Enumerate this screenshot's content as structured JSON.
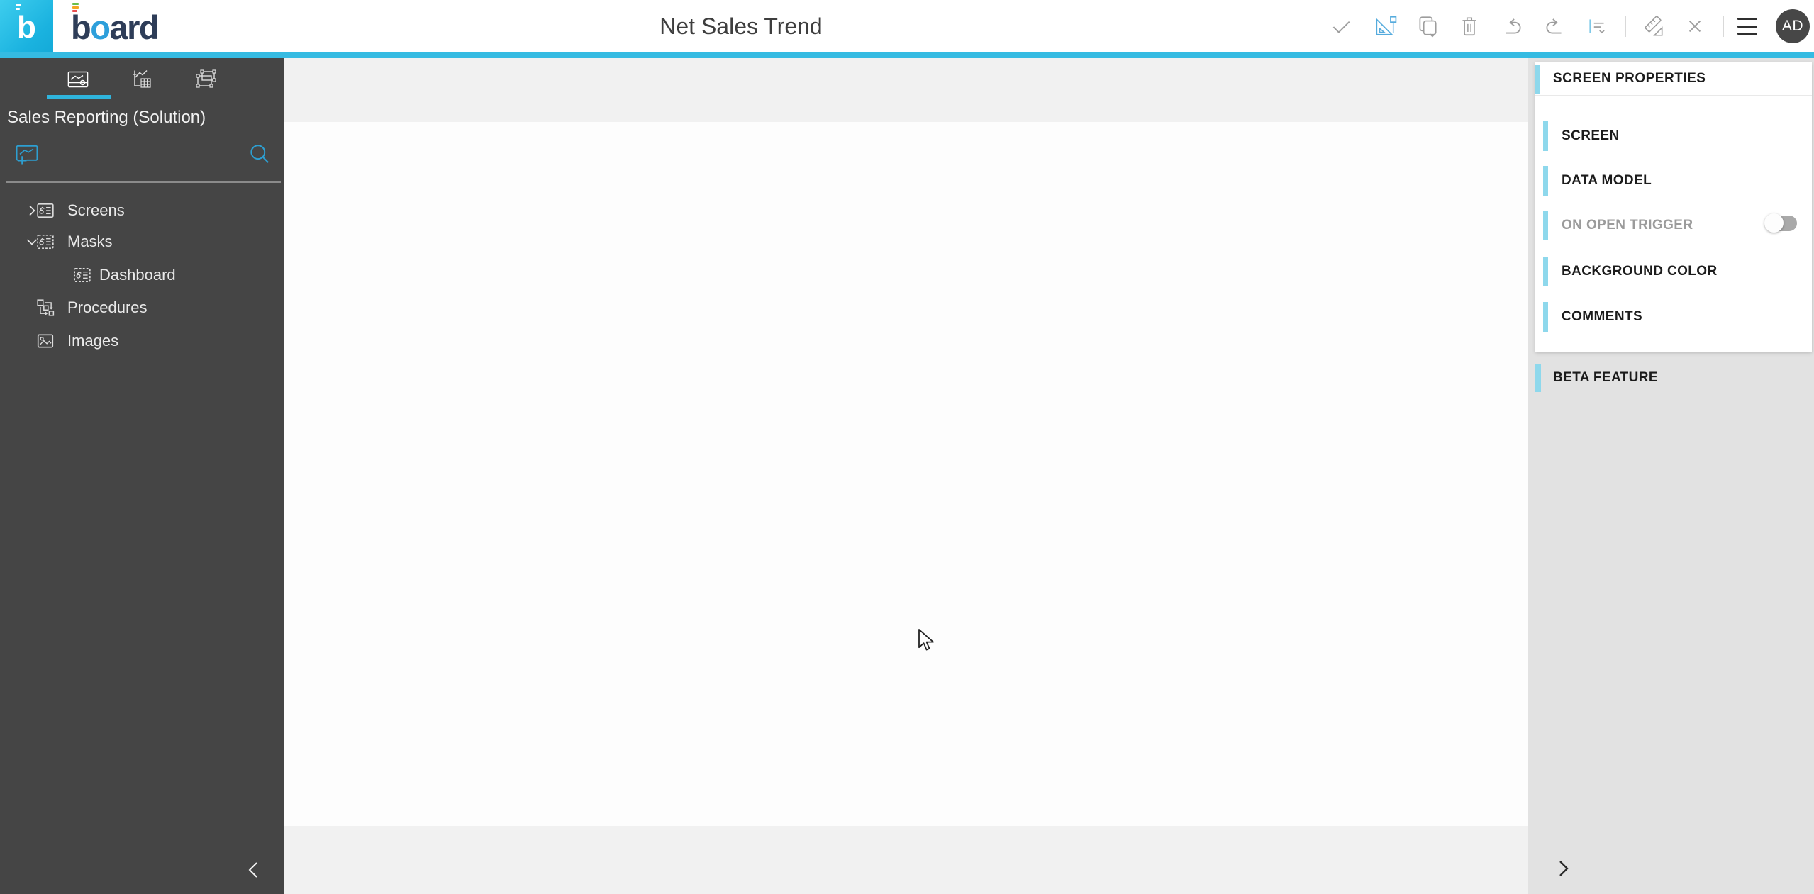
{
  "topbar": {
    "logo_letter": "b",
    "wordmark": {
      "b": "b",
      "o": "o",
      "rest": "ard"
    },
    "title": "Net Sales Trend",
    "avatar_initials": "AD",
    "toolbar_icons": [
      "confirm",
      "select-scale",
      "duplicate",
      "delete",
      "undo",
      "redo",
      "align-options",
      "design-ruler",
      "discard",
      "menu"
    ]
  },
  "sidebar": {
    "solution_name": "Sales Reporting (Solution)",
    "tabs": [
      "capture",
      "analysis",
      "layout"
    ],
    "active_tab": "capture",
    "icons": [
      "add-capture",
      "search"
    ],
    "tree": {
      "screens": "Screens",
      "masks": "Masks",
      "dashboard": "Dashboard",
      "procedures": "Procedures",
      "images": "Images"
    }
  },
  "properties_panel": {
    "header": "SCREEN PROPERTIES",
    "items": {
      "screen": "SCREEN",
      "data_model": "DATA MODEL",
      "on_open_trigger": "ON OPEN TRIGGER",
      "background_color": "BACKGROUND COLOR",
      "comments": "COMMENTS"
    },
    "on_open_trigger_enabled": false,
    "beta_label": "BETA FEATURE"
  },
  "colors": {
    "accent_cyan": "#35bbe2",
    "panel_accent_blue": "#8ed8ec",
    "sidebar_bg": "#454545",
    "toolbar_icon_gray": "#9d9d9d",
    "active_tool_blue": "#55abdd"
  }
}
